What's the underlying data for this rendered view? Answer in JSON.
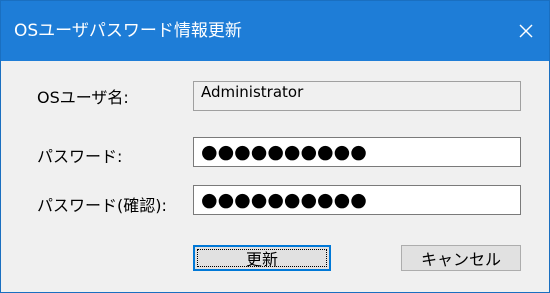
{
  "window": {
    "title": "OSユーザパスワード情報更新",
    "close_icon": "close-icon",
    "titlebar_color": "#1e7dd7"
  },
  "form": {
    "username_label": "OSユーザ名:",
    "username_value": "Administrator",
    "password_label": "パスワード:",
    "password_value": "●●●●●●●●●●",
    "confirm_label": "パスワード(確認):",
    "confirm_value": "●●●●●●●●●●"
  },
  "buttons": {
    "update_label": "更新",
    "cancel_label": "キャンセル"
  }
}
